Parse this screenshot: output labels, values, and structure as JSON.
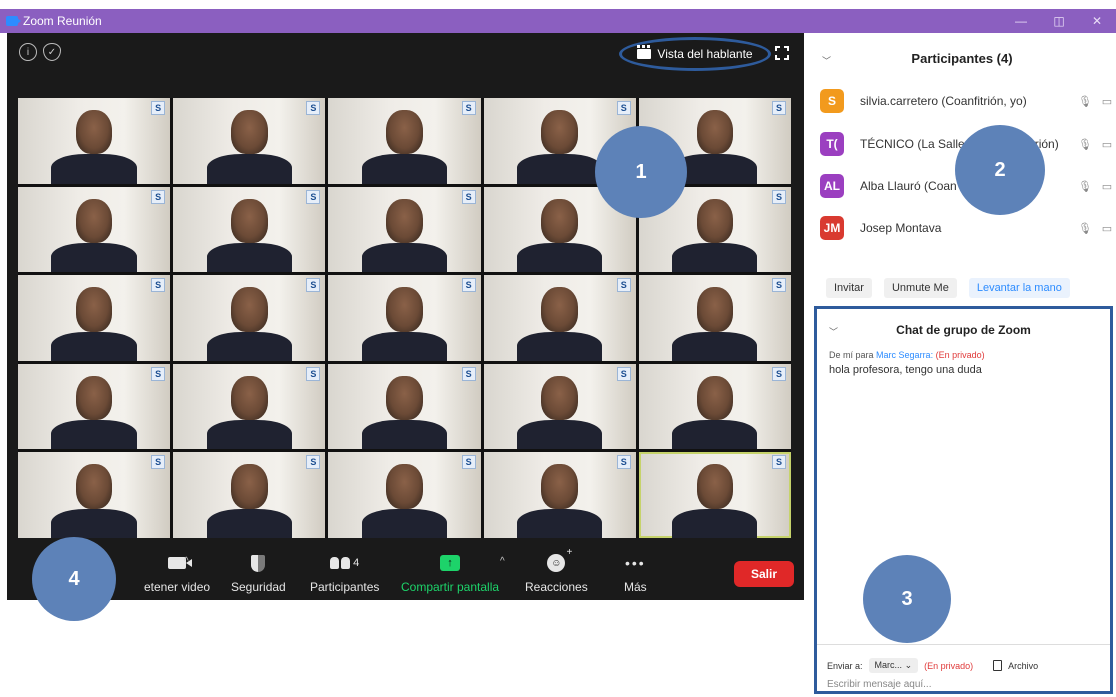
{
  "window": {
    "title": "Zoom Reunión"
  },
  "meeting": {
    "speaker_view_label": "Vista del hablante",
    "tile_badge": "S",
    "tile_count": 25
  },
  "toolbar": {
    "stop_video": "etener video",
    "security": "Seguridad",
    "participants": "Participantes",
    "participants_count": "4",
    "share_screen": "Compartir pantalla",
    "reactions": "Reacciones",
    "more": "Más",
    "leave": "Salir"
  },
  "participants_panel": {
    "title": "Participantes (4)",
    "items": [
      {
        "initials": "S",
        "name": "silvia.carretero (Coanfitrión, yo)",
        "color": "#f29a1d"
      },
      {
        "initials": "T(",
        "name": "TÉCNICO (La Salle",
        "name_tail": "rión)",
        "color": "#9b3fc0"
      },
      {
        "initials": "AL",
        "name": "Alba Llauró (Coan",
        "color": "#9b3fc0"
      },
      {
        "initials": "JM",
        "name": "Josep Montava",
        "color": "#d93a30"
      }
    ],
    "buttons": {
      "invite": "Invitar",
      "unmute": "Unmute Me",
      "raise_hand": "Levantar la mano"
    }
  },
  "chat_panel": {
    "title": "Chat de grupo de Zoom",
    "meta_from": "De mí para",
    "meta_to": "Marc Segarra:",
    "meta_private": "(En privado)",
    "message": "hola profesora, tengo una duda",
    "send_to_label": "Enviar a:",
    "send_to_value": "Marc...",
    "send_private": "(En privado)",
    "file_label": "Archivo",
    "input_placeholder": "Escribir mensaje aquí..."
  },
  "markers": [
    "1",
    "2",
    "3",
    "4"
  ],
  "colors": {
    "titlebar": "#8b5fc0",
    "highlight_border": "#2e5b9c",
    "marker": "#5d82b8",
    "leave": "#e02828",
    "share": "#1dd36a"
  }
}
